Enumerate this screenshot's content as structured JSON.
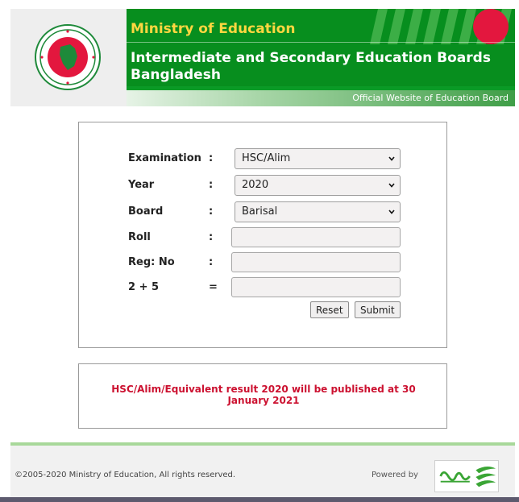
{
  "header": {
    "ministry": "Ministry of Education",
    "board_name": "Intermediate and Secondary Education Boards Bangladesh",
    "official": "Official Website of Education Board",
    "logo_icon": "government-seal-icon"
  },
  "form": {
    "rows": [
      {
        "label": "Examination",
        "sep": ":",
        "value": "HSC/Alim"
      },
      {
        "label": "Year",
        "sep": ":",
        "value": "2020"
      },
      {
        "label": "Board",
        "sep": ":",
        "value": "Barisal"
      },
      {
        "label": "Roll",
        "sep": ":",
        "value": ""
      },
      {
        "label": "Reg: No",
        "sep": ":",
        "value": ""
      },
      {
        "label": "2 + 5",
        "sep": "=",
        "value": ""
      }
    ],
    "reset_label": "Reset",
    "submit_label": "Submit"
  },
  "notice": "HSC/Alim/Equivalent result 2020 will be published at 30 January 2021",
  "footer": {
    "copyright": "©2005-2020 Ministry of Education, All rights reserved.",
    "powered_by": "Powered by",
    "sponsor_icon": "teletalk-logo-icon"
  },
  "colors": {
    "banner_green": "#078e1e",
    "ministry_yellow": "#ffd740",
    "notice_red": "#cc1130"
  }
}
